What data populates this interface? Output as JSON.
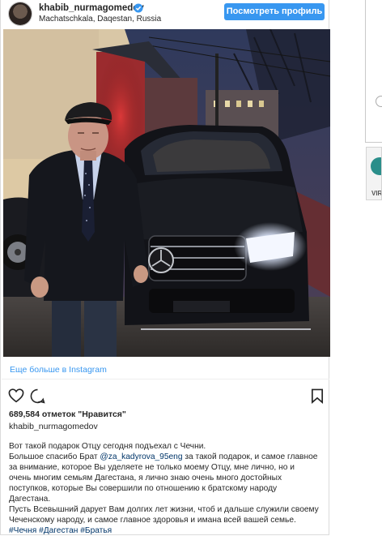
{
  "post": {
    "username": "khabib_nurmagomedov",
    "location": "Machatschkala, Daqestan, Russia",
    "profile_button": "Посмотреть профиль",
    "more_link": "Еще больше в Instagram",
    "likes": "689,584 отметок \"Нравится\"",
    "owner": "khabib_nurmagomedov",
    "caption": {
      "line1": "Вот такой подарок Отцу сегодня подъехал с Чечни.",
      "line2_before": "Большое спасибо Брат ",
      "mention": "@za_kadyrova_95eng",
      "line2_after": " за такой подарок, и самое главное",
      "line3": "за внимание, которое Вы уделяете не только моему Отцу, мне лично, но и",
      "line4": "очень многим семьям Дагестана, я лично знаю очень много достойных",
      "line5": "поступков, которые Вы совершили по отношению к братскому народу",
      "line6": "Дагестана.",
      "line7": "Пусть Всевышний дарует Вам долгих лет жизни, чтоб и дальше служили своему",
      "line8": "Чеченскому народу, и самое главное здоровья и имана всей вашей семье.",
      "hashtags": "#Чечня #Дагестан #Братья"
    }
  },
  "colors": {
    "accent": "#3897f0",
    "link": "#003569",
    "verified": "#3897f0"
  },
  "side": {
    "badge_text": "VIR"
  }
}
